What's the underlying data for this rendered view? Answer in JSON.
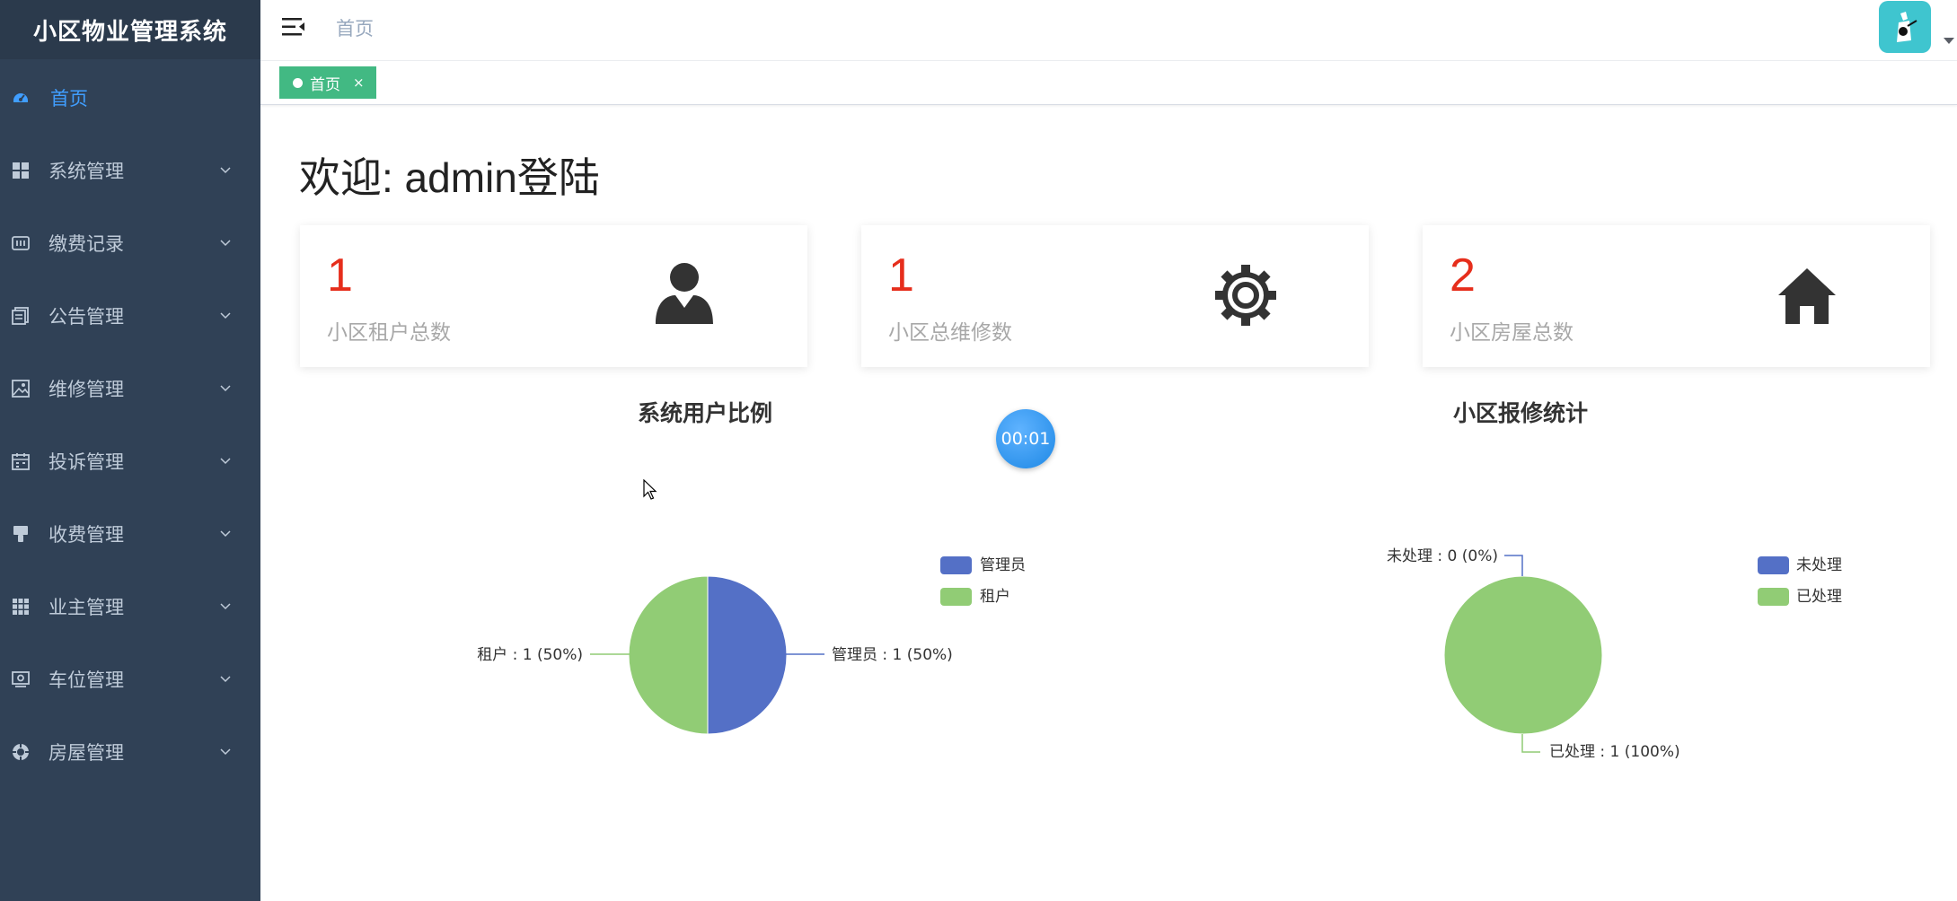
{
  "sidebar": {
    "logo": "小区物业管理系统",
    "items": [
      {
        "label": "首页",
        "icon": "dashboard-icon"
      },
      {
        "label": "系统管理",
        "icon": "grid-icon"
      },
      {
        "label": "缴费记录",
        "icon": "payment-icon"
      },
      {
        "label": "公告管理",
        "icon": "document-icon"
      },
      {
        "label": "维修管理",
        "icon": "image-icon"
      },
      {
        "label": "投诉管理",
        "icon": "calendar-icon"
      },
      {
        "label": "收费管理",
        "icon": "brush-icon"
      },
      {
        "label": "业主管理",
        "icon": "apps-icon"
      },
      {
        "label": "车位管理",
        "icon": "parking-icon"
      },
      {
        "label": "房屋管理",
        "icon": "home-circle-icon"
      }
    ]
  },
  "navbar": {
    "breadcrumb": "首页"
  },
  "tags": [
    {
      "label": "首页",
      "close": "×"
    }
  ],
  "welcome": "欢迎: admin登陆",
  "stats": [
    {
      "value": "1",
      "label": "小区租户总数",
      "icon": "user-icon"
    },
    {
      "value": "1",
      "label": "小区总维修数",
      "icon": "gear-icon"
    },
    {
      "value": "2",
      "label": "小区房屋总数",
      "icon": "house-icon"
    }
  ],
  "timer": "00:01",
  "colors": {
    "sidebar": "#304156",
    "accent": "#409eff",
    "tag": "#42b983",
    "series1": "#5470c6",
    "series2": "#91cc75",
    "stat": "#e62e1c"
  },
  "chart_data": [
    {
      "type": "pie",
      "title": "系统用户比例",
      "legend_position": "top-right",
      "categories": [
        "管理员",
        "租户"
      ],
      "values": [
        1,
        1
      ],
      "labels": [
        "管理员 : 1 (50%)",
        "租户 : 1 (50%)"
      ]
    },
    {
      "type": "pie",
      "title": "小区报修统计",
      "legend_position": "top-right",
      "categories": [
        "未处理",
        "已处理"
      ],
      "values": [
        0,
        1
      ],
      "labels": [
        "未处理 : 0 (0%)",
        "已处理 : 1 (100%)"
      ]
    }
  ]
}
